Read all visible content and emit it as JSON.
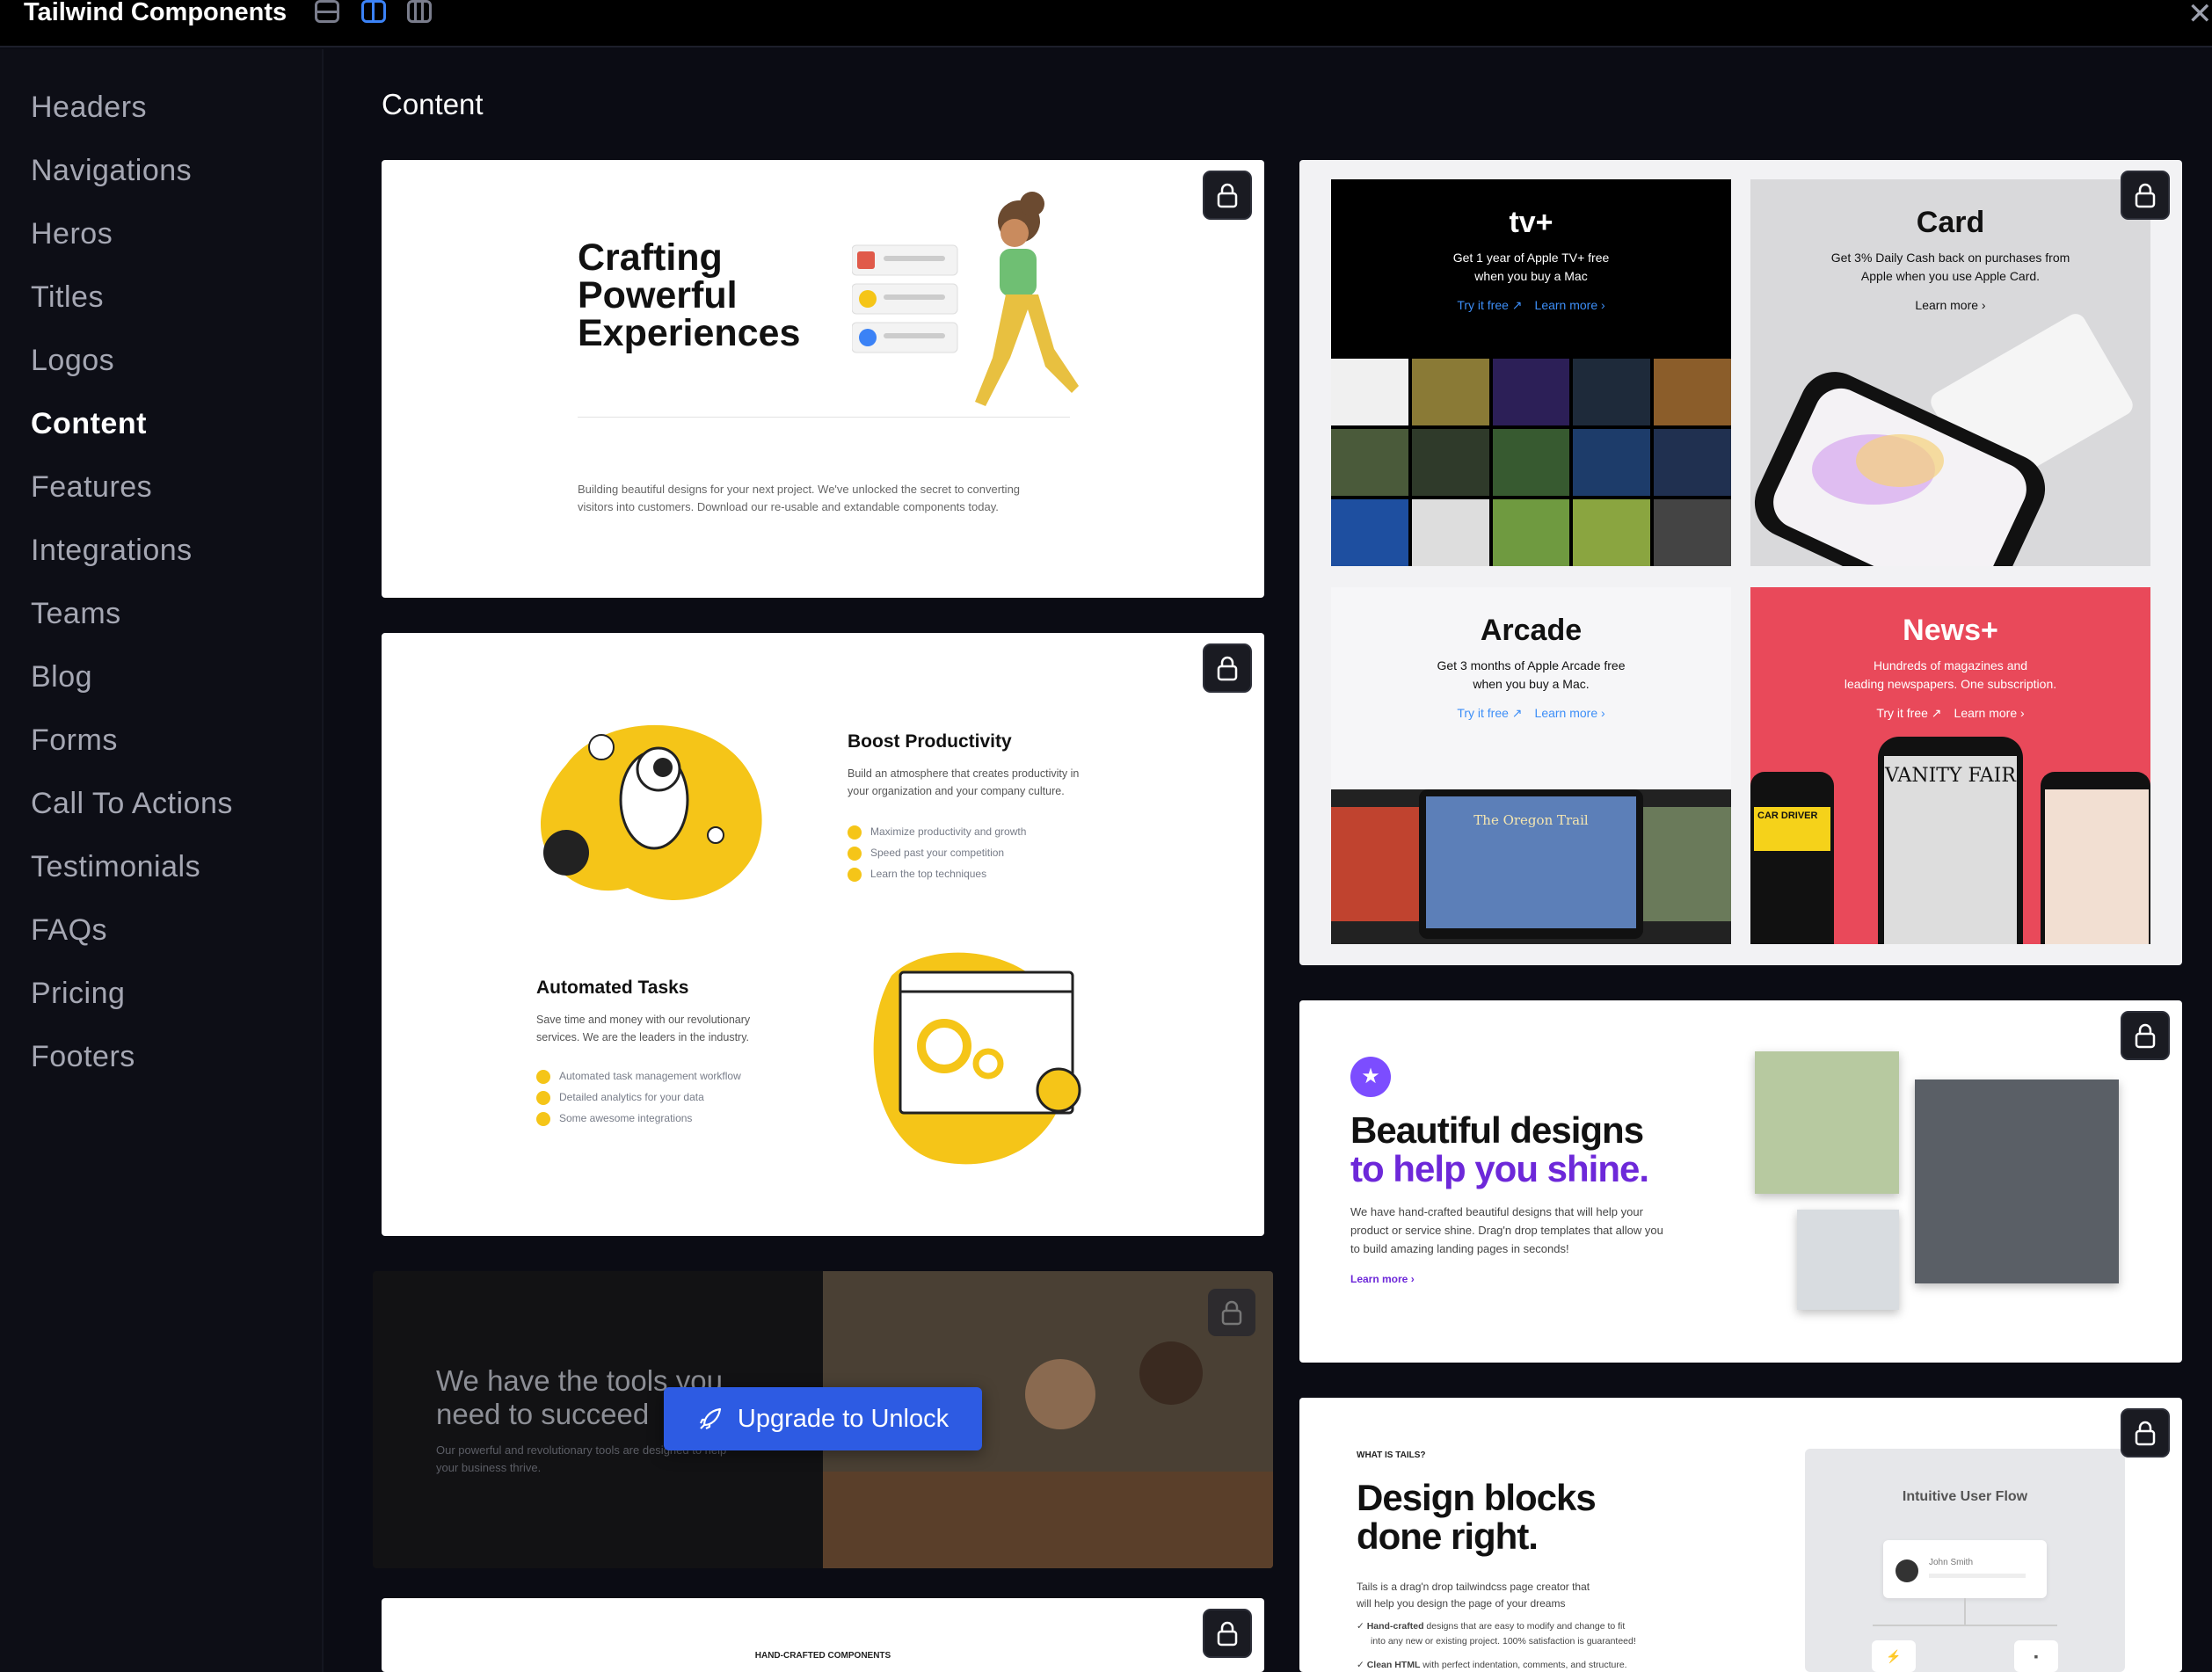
{
  "app": {
    "title": "Tailwind Components"
  },
  "sidebar": {
    "items": [
      {
        "label": "Headers"
      },
      {
        "label": "Navigations"
      },
      {
        "label": "Heros"
      },
      {
        "label": "Titles"
      },
      {
        "label": "Logos"
      },
      {
        "label": "Content",
        "active": true
      },
      {
        "label": "Features"
      },
      {
        "label": "Integrations"
      },
      {
        "label": "Teams"
      },
      {
        "label": "Blog"
      },
      {
        "label": "Forms"
      },
      {
        "label": "Call To Actions"
      },
      {
        "label": "Testimonials"
      },
      {
        "label": "FAQs"
      },
      {
        "label": "Pricing"
      },
      {
        "label": "Footers"
      }
    ]
  },
  "main": {
    "section_title": "Content",
    "upgrade_label": "Upgrade to Unlock",
    "cards": {
      "crafting": {
        "heading_l1": "Crafting",
        "heading_l2": "Powerful",
        "heading_l3": "Experiences",
        "body_l1": "Building beautiful designs for your next project. We've unlocked the secret to converting",
        "body_l2": "visitors into customers. Download our re-usable and extandable components today."
      },
      "apple": {
        "tv": {
          "logo": "tv+",
          "desc_l1": "Get 1 year of Apple TV+ free",
          "desc_l2": "when you buy a Mac",
          "try": "Try it free ↗",
          "learn": "Learn more ›"
        },
        "card": {
          "logo": "Card",
          "desc_l1": "Get 3% Daily Cash back on purchases from",
          "desc_l2": "Apple when you use Apple Card.",
          "learn": "Learn more ›"
        },
        "arcade": {
          "logo": "Arcade",
          "desc_l1": "Get 3 months of Apple Arcade free",
          "desc_l2": "when you buy a Mac.",
          "try": "Try it free ↗",
          "learn": "Learn more ›",
          "game_title": "The Oregon Trail"
        },
        "news": {
          "logo": "News+",
          "desc_l1": "Hundreds of magazines and",
          "desc_l2": "leading newspapers. One subscription.",
          "try": "Try it free ↗",
          "learn": "Learn more ›",
          "mag1": "VANITY FAIR",
          "mag2": "CAR DRIVER"
        }
      },
      "boost": {
        "title1": "Boost Productivity",
        "desc1_l1": "Build an atmosphere that creates productivity in",
        "desc1_l2": "your organization and your company culture.",
        "items1": [
          "Maximize productivity and growth",
          "Speed past your competition",
          "Learn the top techniques"
        ],
        "title2": "Automated Tasks",
        "desc2_l1": "Save time and money with our revolutionary",
        "desc2_l2": "services. We are the leaders in the industry.",
        "items2": [
          "Automated task management workflow",
          "Detailed analytics for your data",
          "Some awesome integrations"
        ]
      },
      "beautiful": {
        "heading_l1": "Beautiful designs",
        "heading_l2": "to help you shine.",
        "body_l1": "We have hand-crafted beautiful designs that will help your",
        "body_l2": "product or service shine. Drag'n drop templates that allow you",
        "body_l3": "to build amazing landing pages in seconds!",
        "link": "Learn more ›"
      },
      "tools": {
        "heading_l1": "We have the tools you",
        "heading_l2": "need to succeed",
        "body_l1": "Our powerful and revolutionary tools are designed to help",
        "body_l2": "your business thrive."
      },
      "design_blocks": {
        "eyebrow": "WHAT IS TAILS?",
        "heading_l1": "Design blocks",
        "heading_l2": "done right.",
        "body_l1": "Tails is a drag'n drop tailwindcss page creator that",
        "body_l2": "will help you design the page of your dreams",
        "b1_bold": "Hand-crafted",
        "b1_rest": " designs that are easy to modify and change to fit",
        "b1_l2": "into any new or existing project. 100% satisfaction is guaranteed!",
        "b2_bold": "Clean HTML",
        "b2_rest": " with perfect indentation, comments, and structure.",
        "flow_title": "Intuitive User Flow",
        "flow_user": "John Smith"
      },
      "handcrafted": {
        "eyebrow": "HAND-CRAFTED COMPONENTS"
      }
    }
  },
  "colors": {
    "accent": "#2d5be3",
    "purple": "#6d28d9",
    "yellow": "#f5c518",
    "news_red": "#e9495a"
  }
}
